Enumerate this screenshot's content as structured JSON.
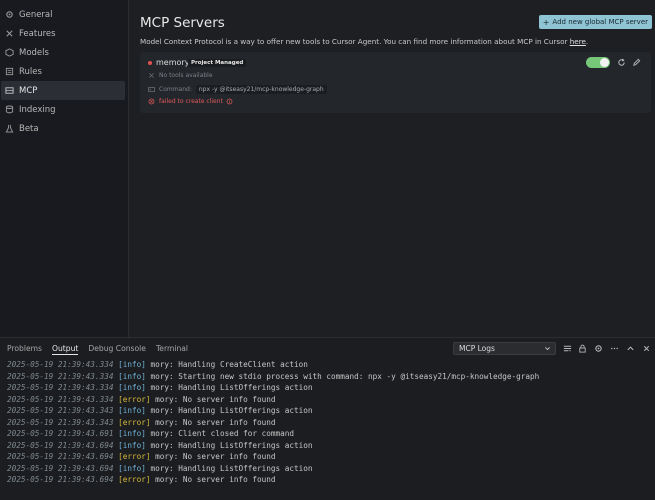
{
  "sidebar": {
    "items": [
      {
        "label": "General",
        "icon": "gear-icon",
        "active": false
      },
      {
        "label": "Features",
        "icon": "tools-icon",
        "active": false
      },
      {
        "label": "Models",
        "icon": "cube-icon",
        "active": false
      },
      {
        "label": "Rules",
        "icon": "list-icon",
        "active": false
      },
      {
        "label": "MCP",
        "icon": "server-icon",
        "active": true
      },
      {
        "label": "Indexing",
        "icon": "database-icon",
        "active": false
      },
      {
        "label": "Beta",
        "icon": "flask-icon",
        "active": false
      }
    ]
  },
  "main": {
    "title": "MCP Servers",
    "add_button": "Add new global MCP server",
    "description": "Model Context Protocol is a way to offer new tools to Cursor Agent. You can find more information about MCP in Cursor ",
    "description_link": "here",
    "description_end": "."
  },
  "server": {
    "name": "memory",
    "badge": "Project Managed",
    "enabled": true,
    "no_tools": "No tools available",
    "command_label": "Command:",
    "command_value": "npx -y @itseasy21/mcp-knowledge-graph",
    "error": "failed to create client"
  },
  "panel": {
    "tabs": [
      {
        "label": "Problems",
        "active": false
      },
      {
        "label": "Output",
        "active": true
      },
      {
        "label": "Debug Console",
        "active": false
      },
      {
        "label": "Terminal",
        "active": false
      }
    ],
    "channel": "MCP Logs"
  },
  "logs": [
    {
      "ts": "2025-05-19 21:39:43.334",
      "level": "[info]",
      "msg": "mory: Handling CreateClient action"
    },
    {
      "ts": "2025-05-19 21:39:43.334",
      "level": "[info]",
      "msg": "mory: Starting new stdio process with command: npx -y @itseasy21/mcp-knowledge-graph"
    },
    {
      "ts": "2025-05-19 21:39:43.334",
      "level": "[info]",
      "msg": "mory: Handling ListOfferings action"
    },
    {
      "ts": "2025-05-19 21:39:43.334",
      "level": "[error]",
      "msg": "mory: No server info found"
    },
    {
      "ts": "2025-05-19 21:39:43.343",
      "level": "[info]",
      "msg": "mory: Handling ListOfferings action"
    },
    {
      "ts": "2025-05-19 21:39:43.343",
      "level": "[error]",
      "msg": "mory: No server info found"
    },
    {
      "ts": "2025-05-19 21:39:43.691",
      "level": "[info]",
      "msg": "mory: Client closed for command"
    },
    {
      "ts": "2025-05-19 21:39:43.694",
      "level": "[info]",
      "msg": "mory: Handling ListOfferings action"
    },
    {
      "ts": "2025-05-19 21:39:43.694",
      "level": "[error]",
      "msg": "mory: No server info found"
    },
    {
      "ts": "2025-05-19 21:39:43.694",
      "level": "[info]",
      "msg": "mory: Handling ListOfferings action"
    },
    {
      "ts": "2025-05-19 21:39:43.694",
      "level": "[error]",
      "msg": "mory: No server info found"
    }
  ],
  "colors": {
    "accent": "#8ec4d3",
    "toggle_on": "#77c77b",
    "error": "#e05252",
    "info": "#6fb4d8",
    "error_level": "#d7ba3d"
  }
}
